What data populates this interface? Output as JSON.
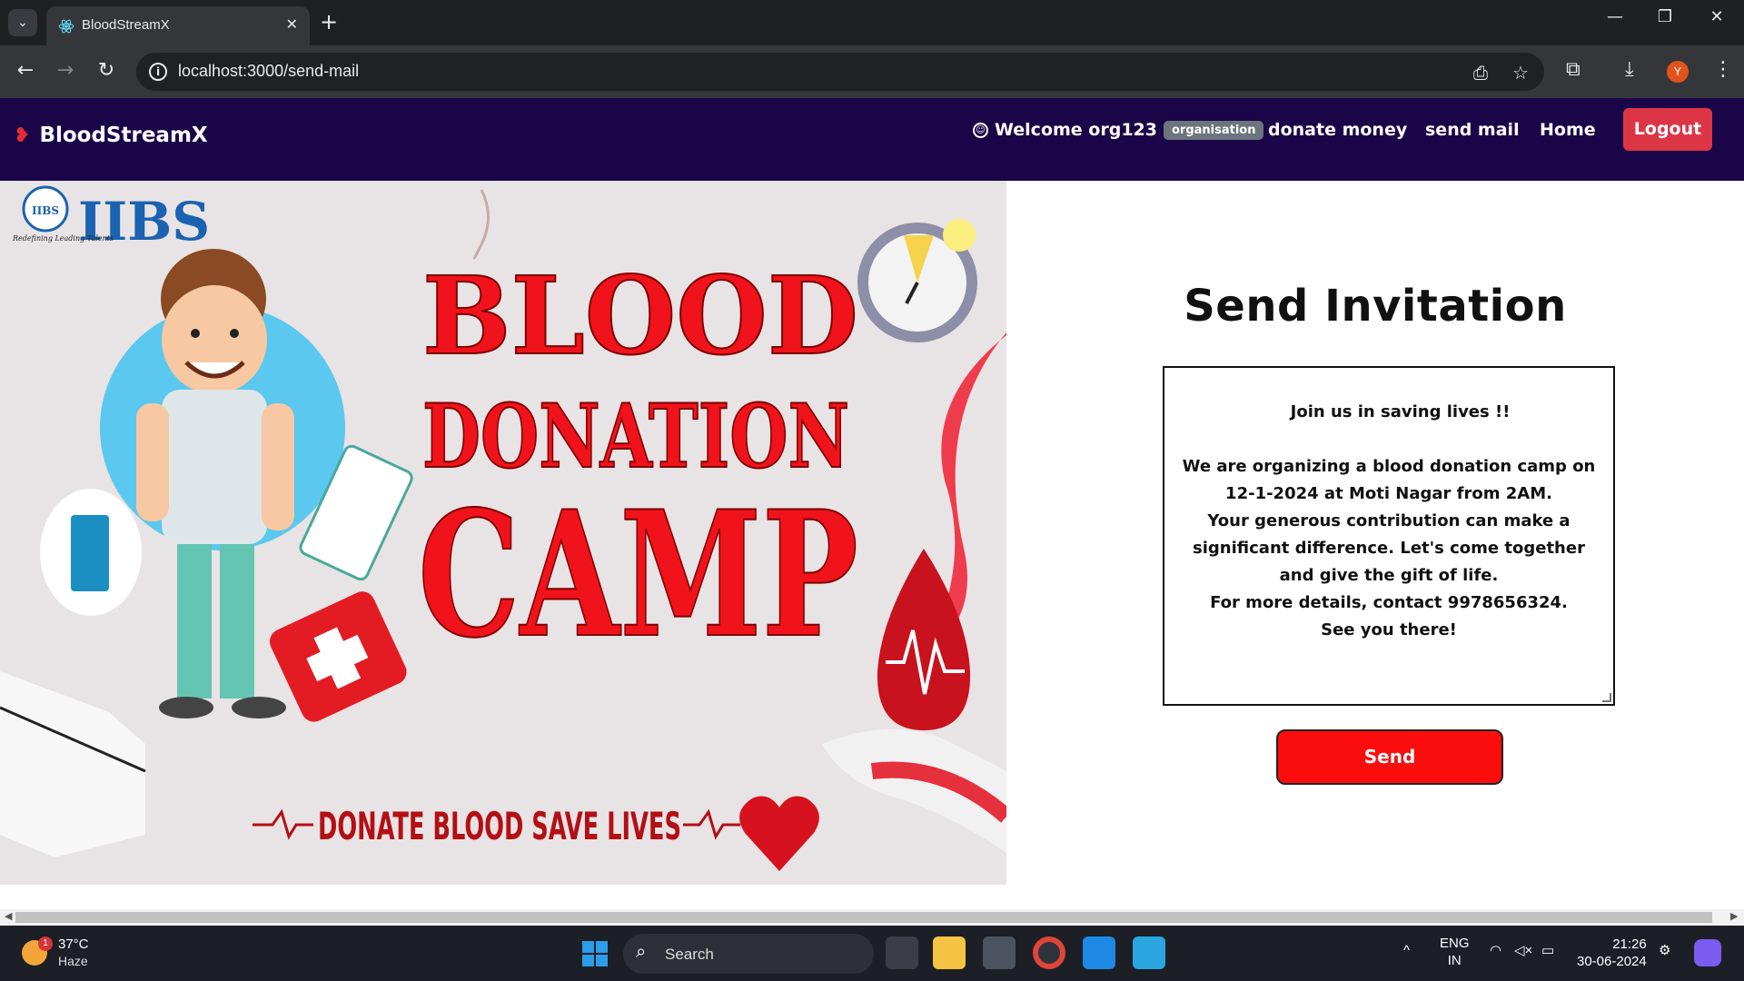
{
  "browser": {
    "tab_title": "BloodStreamX",
    "url": "localhost:3000/send-mail",
    "profile_initial": "Y",
    "new_tab_symbol": "+",
    "tab_close_symbol": "✕"
  },
  "navbar": {
    "brand": "BloodStreamX",
    "welcome": "Welcome org123",
    "role_badge": "organisation",
    "links": [
      "donate money",
      "send mail",
      "Home"
    ],
    "logout_label": "Logout",
    "colors": {
      "background": "#1a0548",
      "logout": "#dc3545"
    }
  },
  "poster": {
    "logo_text": "IIBS",
    "logo_tagline": "Redefining Leading Talents",
    "line1": "BLOOD",
    "line2": "DONATION",
    "line3": "CAMP",
    "slogan": "DONATE BLOOD SAVE LIVES"
  },
  "invitation": {
    "title": "Send Invitation",
    "message": "Join us in saving lives !!\n\nWe are organizing a blood donation camp on 12-1-2024 at Moti Nagar from 2AM.\nYour generous contribution can make a significant difference. Let's come together and give the gift of life.\nFor more details, contact 9978656324.\nSee you there!",
    "send_label": "Send",
    "colors": {
      "send": "#fc0d0d"
    }
  },
  "taskbar": {
    "weather_temp": "37°C",
    "weather_cond": "Haze",
    "weather_badge": "1",
    "search_label": "Search",
    "lang_top": "ENG",
    "lang_bottom": "IN",
    "time": "21:26",
    "date": "30-06-2024"
  }
}
